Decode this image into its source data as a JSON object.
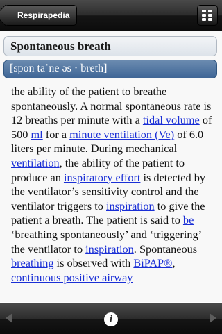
{
  "navbar": {
    "back_label": "Respirapedia",
    "menu_icon": "grid-menu-icon"
  },
  "entry": {
    "title": "Spontaneous breath",
    "pronunciation": "[spon tāˈnē əs · breth]",
    "definition": [
      {
        "t": "the ability of the patient to breathe spontaneously. A normal spontaneous rate is 12 breaths per minute with a "
      },
      {
        "t": "tidal volume",
        "link": true
      },
      {
        "t": " of 500 "
      },
      {
        "t": "ml",
        "link": true
      },
      {
        "t": " for a "
      },
      {
        "t": "minute ventilation (Ve)",
        "link": true
      },
      {
        "t": " of 6.0 liters per minute. During mechanical "
      },
      {
        "t": "ventilation",
        "link": true
      },
      {
        "t": ", the ability of the patient to produce an "
      },
      {
        "t": "inspiratory effort",
        "link": true
      },
      {
        "t": " is detected by the ventilator’s sensitivity control and the ventilator triggers to "
      },
      {
        "t": "inspiration",
        "link": true
      },
      {
        "t": " to give the patient a breath. The patient is said to "
      },
      {
        "t": "be",
        "link": true
      },
      {
        "t": " ‘breathing spontaneously’ and ‘triggering’ the ventilator to "
      },
      {
        "t": "inspiration",
        "link": true
      },
      {
        "t": ". Spontaneous "
      },
      {
        "t": "breathing",
        "link": true
      },
      {
        "t": " is observed with "
      },
      {
        "t": "BiPAP®",
        "link": true
      },
      {
        "t": ", "
      },
      {
        "t": "continuous positive airway",
        "link": true
      }
    ]
  },
  "toolbar": {
    "info_label": "i",
    "prev_icon": "left-arrow-icon",
    "next_icon": "right-arrow-icon"
  },
  "colors": {
    "link": "#1a2fd6",
    "pronunciation_bg": "#4f73a0"
  }
}
